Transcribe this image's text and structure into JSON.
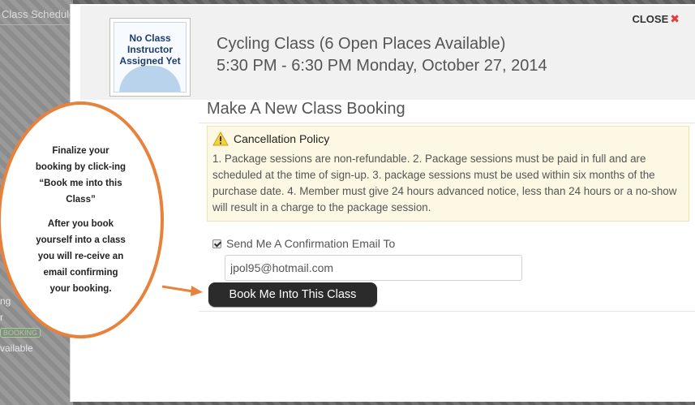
{
  "background": {
    "schedule_title": "Class Schedule",
    "lines": [
      "ng",
      "r",
      "BOOKING",
      "vailable"
    ]
  },
  "modal": {
    "close_label": "CLOSE",
    "close_icon": "x-icon",
    "instructor_image_text": "No Class Instructor Assigned Yet",
    "class_title": "Cycling Class (6 Open Places Available)",
    "class_time": "5:30 PM - 6:30 PM Monday, October 27, 2014",
    "booking_heading": "Make A New Class Booking",
    "policy": {
      "icon": "warning-icon",
      "title": "Cancellation Policy",
      "text": "1. Package sessions are non-refundable. 2. Package sessions must be paid in full and are scheduled at the time of sign-up. 3. package sessions must be used within six months of the purchase date. 4. Member must give 24 hours advanced notice, less than 24 hours or a no-show will result in a charge to the package session."
    },
    "confirm_email": {
      "checked": true,
      "label": "Send Me A Confirmation Email To",
      "value": "jpol95@hotmail.com"
    },
    "book_button_label": "Book Me Into This Class"
  },
  "callout": {
    "paragraph_1": "Finalize your booking by click-ing “Book me into this Class”",
    "paragraph_2": "After you book yourself into a class you will re-ceive an email confirming your booking."
  },
  "colors": {
    "callout_border": "#e8823a",
    "policy_bg": "#fcf8e3",
    "button_bg": "#2b2b2b",
    "close_x": "#e23b3b"
  }
}
